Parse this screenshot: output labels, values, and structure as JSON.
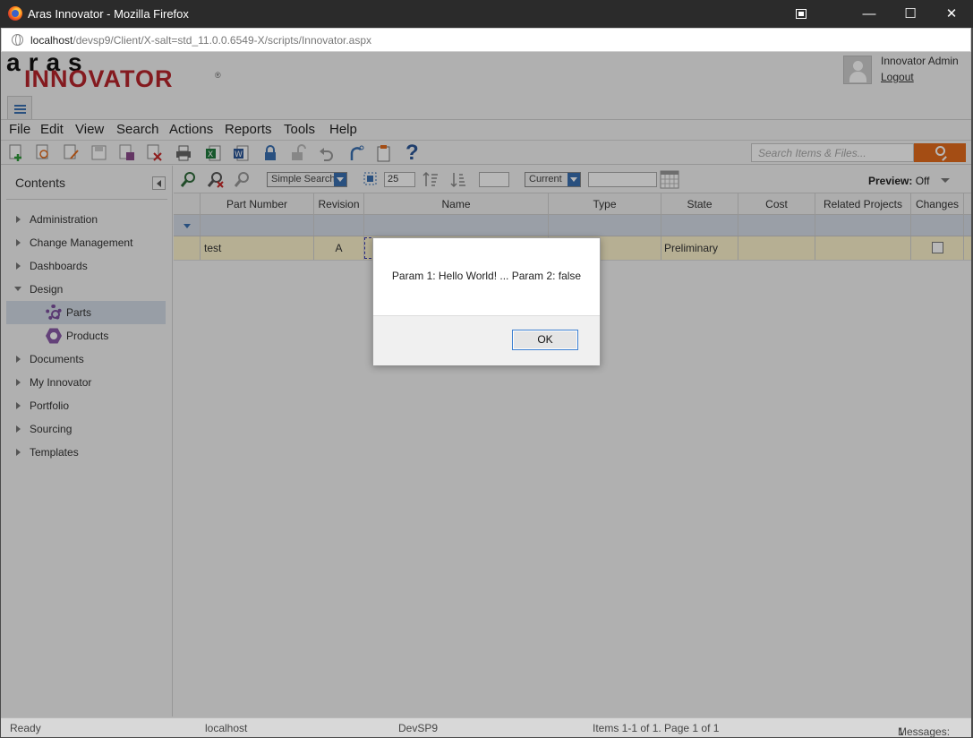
{
  "window": {
    "title": "Aras Innovator - Mozilla Firefox",
    "url_host": "localhost",
    "url_path": "/devsp9/Client/X-salt=std_11.0.0.6549-X/scripts/Innovator.aspx",
    "minimize_glyph": "—",
    "maximize_glyph": "☐",
    "close_glyph": "✕"
  },
  "header": {
    "logo_top": "aras",
    "logo_bottom": "INNOVATOR",
    "logo_reg": "®",
    "user_name": "Innovator Admin",
    "logout": "Logout"
  },
  "menu": [
    "File",
    "Edit",
    "View",
    "Search",
    "Actions",
    "Reports",
    "Tools",
    "Help"
  ],
  "toolbar": {
    "search_placeholder": "Search Items & Files...",
    "help_glyph": "?"
  },
  "sidebar": {
    "title": "Contents",
    "items": [
      {
        "label": "Administration"
      },
      {
        "label": "Change Management"
      },
      {
        "label": "Dashboards"
      },
      {
        "label": "Design"
      },
      {
        "label": "Documents"
      },
      {
        "label": "My Innovator"
      },
      {
        "label": "Portfolio"
      },
      {
        "label": "Sourcing"
      },
      {
        "label": "Templates"
      }
    ],
    "design_children": [
      {
        "label": "Parts",
        "icon": "gear-icon",
        "selected": true
      },
      {
        "label": "Products",
        "icon": "product-icon",
        "selected": false
      }
    ]
  },
  "grid_toolbar": {
    "search_mode": "Simple Search",
    "page_size": "25",
    "version_mode": "Current",
    "preview_label": "Preview:",
    "preview_value": "Off"
  },
  "grid": {
    "columns": [
      "Part Number",
      "Revision",
      "Name",
      "Type",
      "State",
      "Cost",
      "Related Projects",
      "Changes"
    ],
    "rows": [
      {
        "part_number": "test",
        "revision": "A",
        "name": "",
        "type": "",
        "state": "Preliminary",
        "cost": "",
        "related_projects": "",
        "changes": false
      }
    ]
  },
  "dialog": {
    "message": "Param 1: Hello World! ... Param 2: false",
    "ok_label": "OK"
  },
  "status": {
    "state": "Ready",
    "server": "localhost",
    "database": "DevSP9",
    "items": "Items 1-1 of 1. Page 1 of 1",
    "messages_label": "Messages:",
    "messages_count": "1"
  },
  "colors": {
    "accent": "#e36b1d",
    "brand_red": "#b8252b",
    "selection": "#d3dbe6",
    "row_highlight": "#fcf3cc",
    "dialog_focus": "#3c7fd0"
  }
}
